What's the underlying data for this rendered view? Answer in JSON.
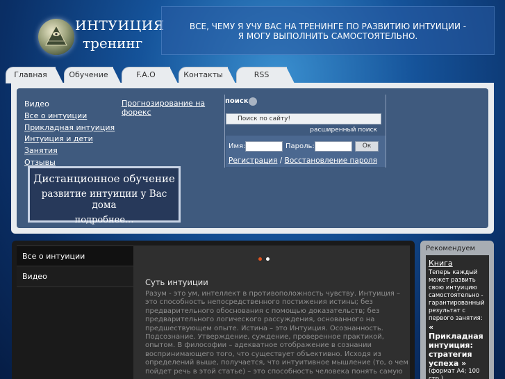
{
  "header": {
    "logo_title": "ИНТУИЦИЯ",
    "logo_subtitle": "тренинг",
    "slogan_line1": "ВСЕ, ЧЕМУ Я УЧУ ВАС НА ТРЕНИНГЕ ПО РАЗВИТИЮ ИНТУИЦИИ -",
    "slogan_line2": "Я МОГУ ВЫПОЛНИТЬ САМОСТОЯТЕЛЬНО."
  },
  "nav": {
    "tabs": [
      {
        "label": "Главная"
      },
      {
        "label": "Обучение"
      },
      {
        "label": "F.A.O"
      },
      {
        "label": "Контакты"
      },
      {
        "label": "RSS"
      }
    ]
  },
  "menu": {
    "col1": [
      {
        "label": "Видео"
      },
      {
        "label": "Все о интуиции"
      },
      {
        "label": "Прикладная интуиция"
      },
      {
        "label": "Интуиция и дети"
      },
      {
        "label": "Занятия"
      },
      {
        "label": "Отзывы"
      }
    ],
    "col2": [
      {
        "label": "Прогнозирование на форекс"
      }
    ]
  },
  "promo": {
    "line1": "Дистанционное обучение",
    "line2": "развитие интуиции у Вас дома",
    "line3": "подробнее..."
  },
  "search": {
    "label": "поиск",
    "placeholder": "Поиск по сайту!",
    "advanced": "расширенный поиск"
  },
  "login": {
    "name_label": "Имя:",
    "pass_label": "Пароль:",
    "ok_label": "Ок",
    "register": "Регистрация",
    "separator": "/",
    "restore": "Восстановление пароля"
  },
  "main": {
    "side_tabs": [
      {
        "label": "Все о интуиции"
      },
      {
        "label": "Видео"
      }
    ],
    "slider_dots": {
      "active_color": "#e0541f",
      "inactive_color": "#ffffff"
    },
    "title": "Суть интуиции",
    "body": "Разум - это ум, интеллект в противоположность чувству. Интуиция – это способность непосредственного постижения истины; без предварительного обоснования с помощью доказательств; без предварительного логического рассуждения, основанного на предшествующем опыте. Истина – это Интуиция. Осознанность. Подсознание. Утверждение, суждение, проверенное практикой, опытом. В философии – адекватное отображение в сознании воспринимающего того, что существует объективно. Исходя из определений выше, получается, что интуитивное мышление (то, о чем пойдет речь в этой статье) – это способность человека понять самую"
  },
  "recommend": {
    "title": "Рекомендуем",
    "book_link": "Книга",
    "text": "Теперь каждый может развить свою интуицию самостоятельно - гарантированный результат с первого занятия:",
    "book_title": "« Прикладная интуиция: стратегия успеха »",
    "format": "(формат А4; 100 стр.)"
  }
}
